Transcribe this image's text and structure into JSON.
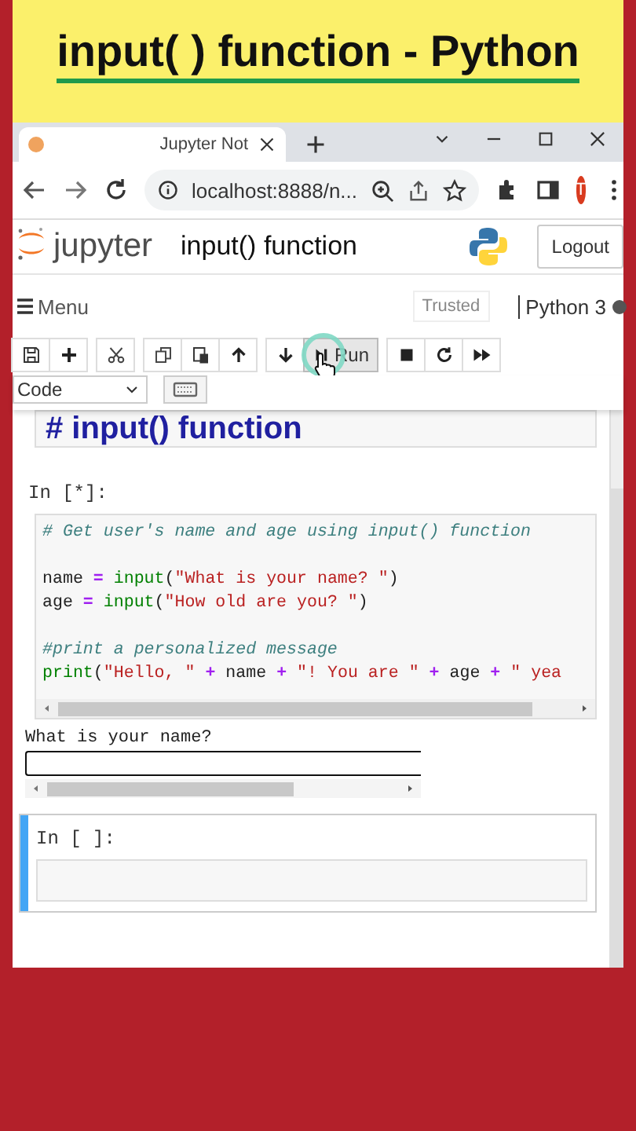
{
  "banner": {
    "title": "input( ) function - Python"
  },
  "browser": {
    "tab_title": "Jupyter Not",
    "url": "localhost:8888/n...",
    "profile_initial": "T"
  },
  "header": {
    "app_name": "jupyter",
    "notebook_title": "input() function",
    "logout": "Logout"
  },
  "menubar": {
    "menu": "Menu",
    "trusted": "Trusted",
    "kernel": "Python 3",
    "kernel_busy": true
  },
  "toolbar": [
    {
      "kind": "save",
      "highlighted": false
    },
    {
      "kind": "add",
      "highlighted": false
    },
    {
      "kind": "cut",
      "highlighted": false
    },
    {
      "kind": "copy",
      "highlighted": false
    },
    {
      "kind": "paste",
      "highlighted": false
    },
    {
      "kind": "up",
      "highlighted": false
    },
    {
      "kind": "down",
      "highlighted": false
    },
    {
      "kind": "run",
      "label": "Run",
      "highlighted": true
    },
    {
      "kind": "stop",
      "highlighted": false
    },
    {
      "kind": "restart",
      "highlighted": false
    },
    {
      "kind": "forward",
      "highlighted": false
    }
  ],
  "cell_type": "Code",
  "cells": [
    {
      "kind": "markdown",
      "text": "# input() function"
    },
    {
      "kind": "code",
      "prompt": "In [*]:",
      "selected": false,
      "lines": [
        {
          "kind": "code",
          "tokens": [
            {
              "kind": "comment",
              "text": "# Get user's name and age using input() function"
            }
          ]
        },
        {
          "kind": "blank"
        },
        {
          "kind": "code",
          "tokens": [
            {
              "kind": "name",
              "text": "name "
            },
            {
              "kind": "op",
              "text": "="
            },
            {
              "kind": "builtin",
              "text": " input"
            },
            {
              "kind": "name",
              "text": "("
            },
            {
              "kind": "string",
              "text": "\"What is your name? \""
            },
            {
              "kind": "name",
              "text": ")"
            }
          ]
        },
        {
          "kind": "code",
          "tokens": [
            {
              "kind": "name",
              "text": "age "
            },
            {
              "kind": "op",
              "text": "="
            },
            {
              "kind": "builtin",
              "text": " input"
            },
            {
              "kind": "name",
              "text": "("
            },
            {
              "kind": "string",
              "text": "\"How old are you? \""
            },
            {
              "kind": "name",
              "text": ")"
            }
          ]
        },
        {
          "kind": "blank"
        },
        {
          "kind": "code",
          "tokens": [
            {
              "kind": "comment",
              "text": "#print a personalized message"
            }
          ]
        },
        {
          "kind": "code",
          "tokens": [
            {
              "kind": "builtin",
              "text": "print"
            },
            {
              "kind": "name",
              "text": "("
            },
            {
              "kind": "string",
              "text": "\"Hello, \""
            },
            {
              "kind": "op",
              "text": " +"
            },
            {
              "kind": "name",
              "text": " name "
            },
            {
              "kind": "op",
              "text": "+"
            },
            {
              "kind": "string",
              "text": " \"! You are \""
            },
            {
              "kind": "op",
              "text": " +"
            },
            {
              "kind": "name",
              "text": " age "
            },
            {
              "kind": "op",
              "text": "+"
            },
            {
              "kind": "string",
              "text": " \" yea"
            }
          ]
        }
      ],
      "output": {
        "prompt_text": "What is your name?"
      }
    },
    {
      "kind": "code",
      "prompt": "In [ ]:",
      "selected": true
    }
  ]
}
